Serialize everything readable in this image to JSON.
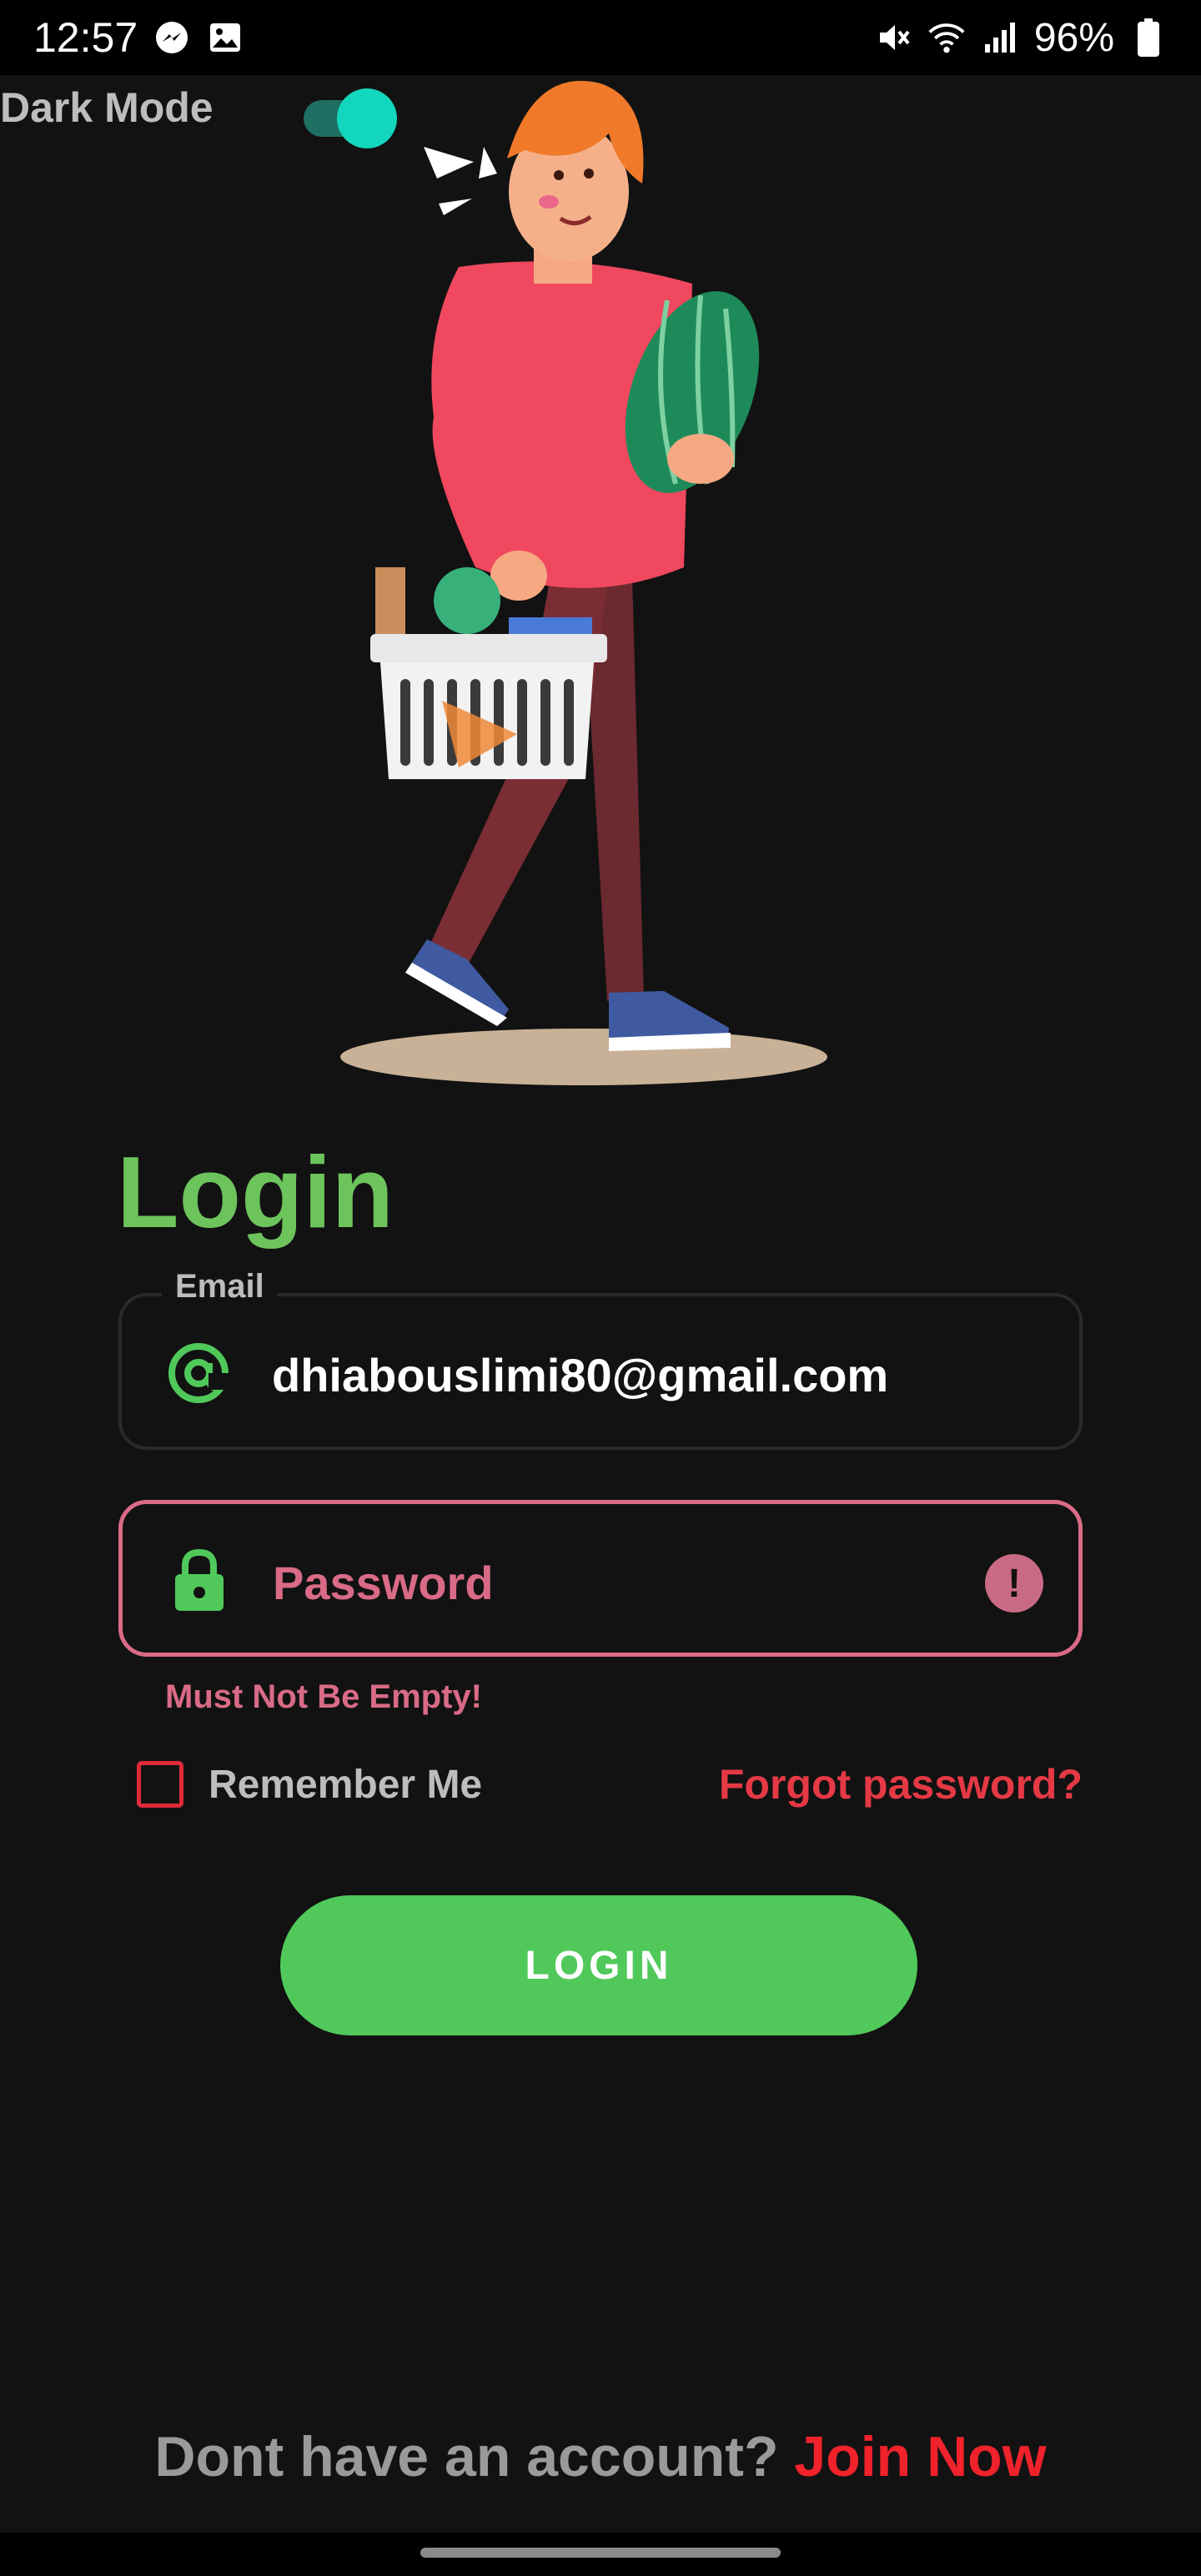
{
  "status_bar": {
    "time": "12:57",
    "battery": "96%",
    "left_icons": [
      "messenger-icon",
      "gallery-icon"
    ],
    "right_icons": [
      "mute-icon",
      "wifi-icon",
      "signal-icon",
      "battery-icon"
    ]
  },
  "theme_toggle": {
    "label": "Dark Mode",
    "enabled": true
  },
  "hero": {
    "icon": "shopping-person-illustration"
  },
  "login_form": {
    "title": "Login",
    "email": {
      "label": "Email",
      "value": "dhiabouslimi80@gmail.com",
      "icon": "at-icon"
    },
    "password": {
      "placeholder": "Password",
      "icon": "lock-icon",
      "error_icon": "alert-icon",
      "error_message": "Must Not Be Empty!"
    },
    "remember_me": {
      "label": "Remember Me",
      "checked": false
    },
    "forgot_password": "Forgot password?",
    "submit_label": "LOGIN"
  },
  "signup": {
    "prompt": "Dont have an account?",
    "link": "Join Now"
  },
  "colors": {
    "background": "#121212",
    "accent_green": "#50c95a",
    "title_green": "#6dc45c",
    "error_pink": "#d96b86",
    "link_red": "#e53945",
    "toggle_teal": "#12d6bd"
  }
}
